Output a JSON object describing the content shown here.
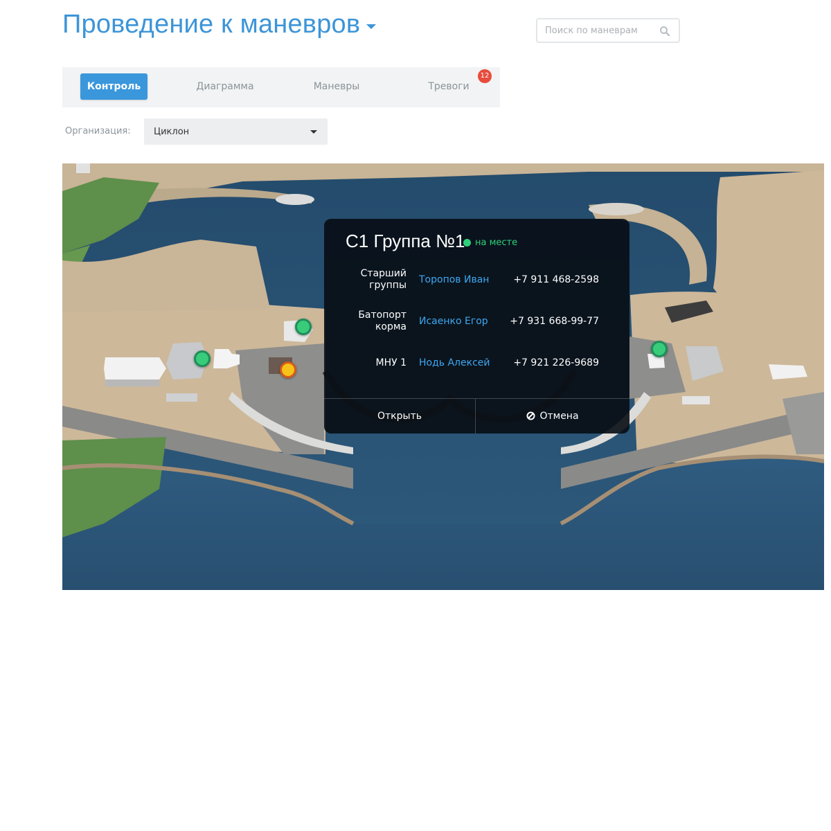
{
  "header": {
    "title": "Проведение к маневров"
  },
  "search": {
    "placeholder": "Поиск по маневрам",
    "icon": "search-icon"
  },
  "tabs": [
    {
      "label": "Контроль",
      "active": true
    },
    {
      "label": "Диаграмма",
      "active": false
    },
    {
      "label": "Маневры",
      "active": false
    },
    {
      "label": "Тревоги",
      "active": false,
      "badge": "12"
    }
  ],
  "organization": {
    "label": "Организация:",
    "value": "Циклон"
  },
  "map": {
    "markers": [
      {
        "status": "ok"
      },
      {
        "status": "ok"
      },
      {
        "status": "warning"
      },
      {
        "status": "ok"
      }
    ]
  },
  "popup": {
    "title": "С1 Группа №1",
    "status": "на месте",
    "rows": [
      {
        "role": "Старший группы",
        "name": "Торопов Иван",
        "phone": "+7 911 468-2598"
      },
      {
        "role": "Батопорт корма",
        "name": "Исаенко Егор",
        "phone": "+7 931 668-99-77"
      },
      {
        "role": "МНУ 1",
        "name": "Нодь Алексей",
        "phone": "+7 921 226-9689"
      }
    ],
    "open_label": "Открыть",
    "cancel_label": "Отмена"
  },
  "colors": {
    "accent": "#3a97dc",
    "status_ok": "#2fd07a",
    "status_warning": "#f7c21a",
    "badge": "#e74c3c",
    "water": "#2d5778",
    "land": "#cdb89a"
  }
}
